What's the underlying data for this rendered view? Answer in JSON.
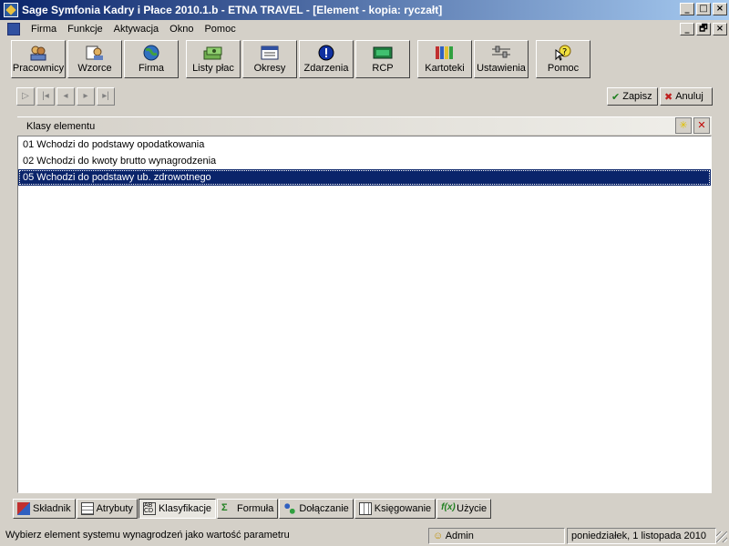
{
  "window": {
    "title": "Sage Symfonia Kadry i Płace 2010.1.b - ETNA TRAVEL - [Element - kopia: ryczałt]",
    "buttons": [
      "_",
      "□",
      "×"
    ],
    "mdi_buttons": [
      "_",
      "🗗",
      "×"
    ]
  },
  "menu": {
    "items": [
      {
        "label": "Firma"
      },
      {
        "label": "Funkcje"
      },
      {
        "label": "Aktywacja"
      },
      {
        "label": "Okno"
      },
      {
        "label": "Pomoc"
      }
    ]
  },
  "toolbar": {
    "buttons": [
      {
        "label": "Pracownicy",
        "icon": "people-icon"
      },
      {
        "label": "Wzorce",
        "icon": "templates-icon"
      },
      {
        "label": "Firma",
        "icon": "globe-icon"
      },
      {
        "label": "Listy płac",
        "icon": "money-icon"
      },
      {
        "label": "Okresy",
        "icon": "calendar-icon"
      },
      {
        "label": "Zdarzenia",
        "icon": "info-icon"
      },
      {
        "label": "RCP",
        "icon": "rcp-icon"
      },
      {
        "label": "Kartoteki",
        "icon": "binders-icon"
      },
      {
        "label": "Ustawienia",
        "icon": "sliders-icon"
      },
      {
        "label": "Pomoc",
        "icon": "help-icon"
      }
    ]
  },
  "navigation": {
    "buttons": [
      "first-icon",
      "prev-page-icon",
      "prev-icon",
      "next-icon",
      "last-icon"
    ]
  },
  "actions": {
    "save_label": "Zapisz",
    "cancel_label": "Anuluj"
  },
  "panel": {
    "title": "Klasy elementu",
    "items": [
      {
        "label": "01 Wchodzi do podstawy opodatkowania",
        "selected": false
      },
      {
        "label": "02 Wchodzi do kwoty brutto wynagrodzenia",
        "selected": false
      },
      {
        "label": "05 Wchodzi do podstawy ub. zdrowotnego",
        "selected": true
      }
    ]
  },
  "tabs": [
    {
      "label": "Składnik",
      "active": false
    },
    {
      "label": "Atrybuty",
      "active": false
    },
    {
      "label": "Klasyfikacje",
      "active": true
    },
    {
      "label": "Formuła",
      "active": false
    },
    {
      "label": "Dołączanie",
      "active": false
    },
    {
      "label": "Księgowanie",
      "active": false
    },
    {
      "label": "Użycie",
      "active": false
    }
  ],
  "status": {
    "hint": "Wybierz element systemu wynagrodzeń jako wartość parametru",
    "user": "Admin",
    "date": "poniedziałek, 1 listopada 2010"
  },
  "colors": {
    "title_gradient_start": "#0a246a",
    "selection": "#0a246a",
    "face": "#d4d0c8"
  }
}
